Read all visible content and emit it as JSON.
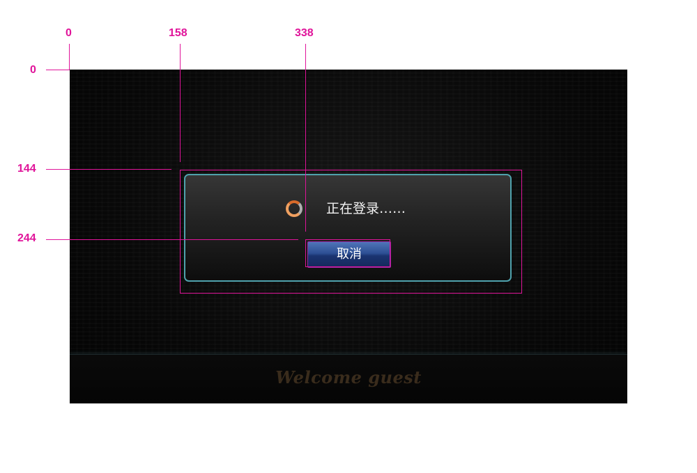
{
  "annotations": {
    "x_markers": [
      "0",
      "158",
      "338"
    ],
    "y_markers": [
      "0",
      "144",
      "244"
    ]
  },
  "dialog": {
    "loading_text": "正在登录……",
    "spinner_icon": "loading-spinner-icon",
    "cancel_label": "取消"
  },
  "footer": {
    "welcome_text": "Welcome guest"
  },
  "colors": {
    "annotation": "#e0149a",
    "dialog_border": "#4fa2ad",
    "button": "#2d4f94",
    "spinner": "#f0a060"
  }
}
